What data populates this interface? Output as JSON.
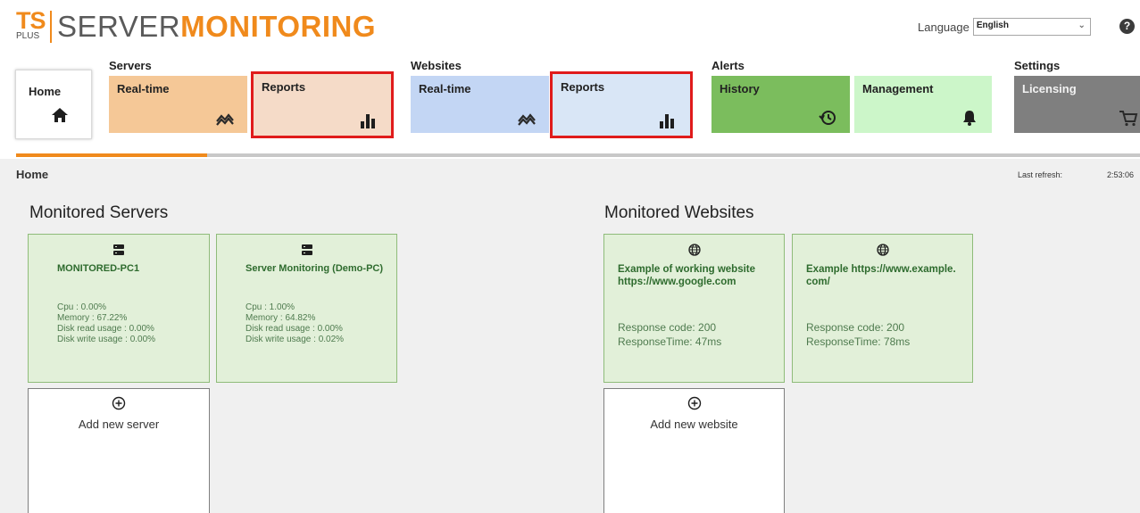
{
  "header": {
    "logo_ts": "TS",
    "logo_plus": "PLUS",
    "logo_word1": "SERVER",
    "logo_word2": "MONITORING",
    "language_label": "Language",
    "language_value": "English",
    "help_icon": "question-circle-icon"
  },
  "nav": {
    "home": {
      "label": "Home",
      "icon": "home-icon"
    },
    "groups": {
      "servers": "Servers",
      "websites": "Websites",
      "alerts": "Alerts",
      "settings": "Settings"
    },
    "servers_realtime": {
      "label": "Real-time",
      "icon": "realtime-chart-icon",
      "color": "#f5c897"
    },
    "servers_reports": {
      "label": "Reports",
      "icon": "bar-chart-icon",
      "color": "#f5dbc8",
      "highlighted": true
    },
    "websites_realtime": {
      "label": "Real-time",
      "icon": "realtime-chart-icon",
      "color": "#c3d6f4"
    },
    "websites_reports": {
      "label": "Reports",
      "icon": "bar-chart-icon",
      "color": "#d9e6f6",
      "highlighted": true
    },
    "alerts_history": {
      "label": "History",
      "icon": "history-icon",
      "color": "#7bbd5d"
    },
    "alerts_management": {
      "label": "Management",
      "icon": "bell-icon",
      "color": "#ccf6c9"
    },
    "settings_licensing": {
      "label": "Licensing",
      "icon": "cart-icon",
      "color": "#7f7f7f"
    },
    "page_progress": 0.17
  },
  "page": {
    "breadcrumb": "Home",
    "last_refresh_label": "Last refresh:",
    "last_refresh_time": "2:53:06"
  },
  "servers": {
    "title": "Monitored Servers",
    "cards": [
      {
        "name": "MONITORED-PC1",
        "cpu": "Cpu : 0.00%",
        "memory": "Memory : 67.22%",
        "disk_read": "Disk read usage : 0.00%",
        "disk_write": "Disk write usage : 0.00%"
      },
      {
        "name": "Server Monitoring (Demo-PC)",
        "cpu": "Cpu : 1.00%",
        "memory": "Memory : 64.82%",
        "disk_read": "Disk read usage : 0.00%",
        "disk_write": "Disk write usage : 0.02%"
      }
    ],
    "add_label": "Add new server"
  },
  "websites": {
    "title": "Monitored Websites",
    "cards": [
      {
        "name": "Example of working website https://www.google.com",
        "response_code": "Response code: 200",
        "response_time": "ResponseTime: 47ms"
      },
      {
        "name": "Example https://www.example.com/",
        "response_code": "Response code: 200",
        "response_time": "ResponseTime: 78ms"
      }
    ],
    "add_label": "Add new website"
  },
  "colors": {
    "accent": "#f08a1c",
    "highlight": "#e01b1b",
    "card_bg": "#e2f0d9",
    "card_text": "#2e6b2e"
  }
}
